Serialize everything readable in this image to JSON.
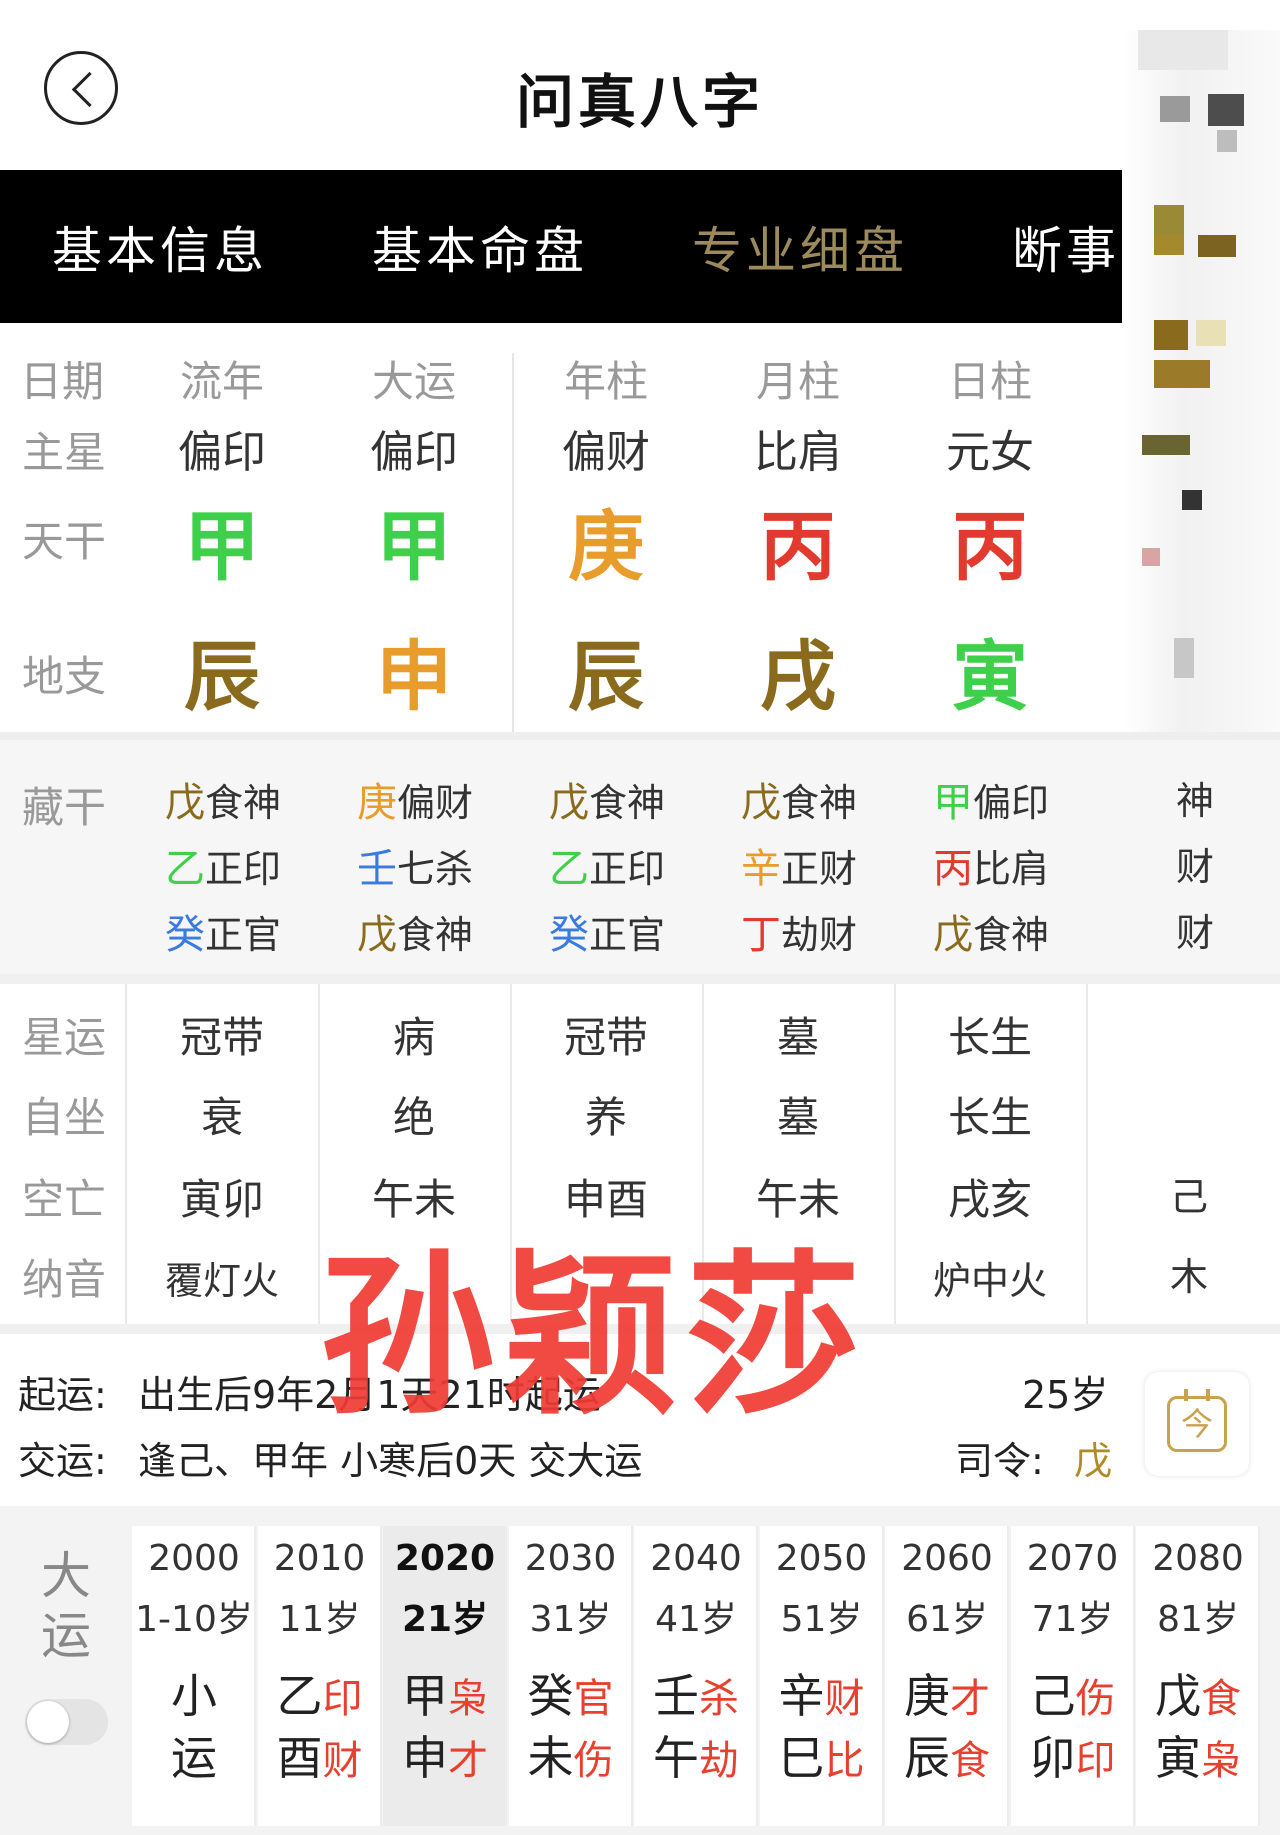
{
  "header": {
    "title": "问真八字"
  },
  "tabs": [
    "基本信息",
    "基本命盘",
    "专业细盘",
    "断事笔记"
  ],
  "row_labels": {
    "date": "日期",
    "star": "主星",
    "stem": "天干",
    "branch": "地支"
  },
  "columns": [
    {
      "head": "流年",
      "star": "偏印",
      "stem": "甲",
      "stem_color": "#3ed04a",
      "branch": "辰",
      "branch_color": "#8a6a1c"
    },
    {
      "head": "大运",
      "star": "偏印",
      "stem": "甲",
      "stem_color": "#3ed04a",
      "branch": "申",
      "branch_color": "#e79c2b"
    },
    {
      "head": "年柱",
      "star": "偏财",
      "stem": "庚",
      "stem_color": "#e79c2b",
      "branch": "辰",
      "branch_color": "#8a6a1c"
    },
    {
      "head": "月柱",
      "star": "比肩",
      "stem": "丙",
      "stem_color": "#e23a2f",
      "branch": "戌",
      "branch_color": "#8a6a1c"
    },
    {
      "head": "日柱",
      "star": "元女",
      "stem": "丙",
      "stem_color": "#e23a2f",
      "branch": "寅",
      "branch_color": "#3ed04a"
    }
  ],
  "hidden": {
    "label": "藏干",
    "columns": [
      [
        {
          "g": "戊",
          "c": "#8a6a1c",
          "t": "食神"
        },
        {
          "g": "乙",
          "c": "#3ed04a",
          "t": "正印"
        },
        {
          "g": "癸",
          "c": "#3a7be0",
          "t": "正官"
        }
      ],
      [
        {
          "g": "庚",
          "c": "#e79c2b",
          "t": "偏财"
        },
        {
          "g": "壬",
          "c": "#3a7be0",
          "t": "七杀"
        },
        {
          "g": "戊",
          "c": "#8a6a1c",
          "t": "食神"
        }
      ],
      [
        {
          "g": "戊",
          "c": "#8a6a1c",
          "t": "食神"
        },
        {
          "g": "乙",
          "c": "#3ed04a",
          "t": "正印"
        },
        {
          "g": "癸",
          "c": "#3a7be0",
          "t": "正官"
        }
      ],
      [
        {
          "g": "戊",
          "c": "#8a6a1c",
          "t": "食神"
        },
        {
          "g": "辛",
          "c": "#e79c2b",
          "t": "正财"
        },
        {
          "g": "丁",
          "c": "#e23a2f",
          "t": "劫财"
        }
      ],
      [
        {
          "g": "甲",
          "c": "#3ed04a",
          "t": "偏印"
        },
        {
          "g": "丙",
          "c": "#e23a2f",
          "t": "比肩"
        },
        {
          "g": "戊",
          "c": "#8a6a1c",
          "t": "食神"
        }
      ]
    ],
    "partial": [
      "神",
      "财",
      "财"
    ]
  },
  "luck": {
    "labels": [
      "星运",
      "自坐",
      "空亡",
      "纳音"
    ],
    "columns": [
      [
        "冠带",
        "衰",
        "寅卯",
        "覆灯火"
      ],
      [
        "病",
        "绝",
        "午未",
        ""
      ],
      [
        "冠带",
        "养",
        "申酉",
        ""
      ],
      [
        "墓",
        "墓",
        "午未",
        ""
      ],
      [
        "长生",
        "长生",
        "戌亥",
        "炉中火"
      ]
    ],
    "partial": [
      "",
      "",
      "己",
      "木"
    ]
  },
  "watermark": "孙颖莎",
  "info": {
    "qiyun_label": "起运:",
    "qiyun_text": "出生后9年2月1天21时起运",
    "jiaoyun_label": "交运:",
    "jiaoyun_text": "逢己、甲年 小寒后0天 交大运",
    "age": "25岁",
    "siling_label": "司令:",
    "siling_value": "戊",
    "calendar_glyph": "今"
  },
  "dayun": {
    "label_1": "大",
    "label_2": "运",
    "columns": [
      {
        "year": "2000",
        "age": "1-10岁",
        "s1": "小",
        "g1": "",
        "s2": "运",
        "g2": ""
      },
      {
        "year": "2010",
        "age": "11岁",
        "s1": "乙",
        "g1": "印",
        "s2": "酉",
        "g2": "财"
      },
      {
        "year": "2020",
        "age": "21岁",
        "s1": "甲",
        "g1": "枭",
        "s2": "申",
        "g2": "才",
        "current": true
      },
      {
        "year": "2030",
        "age": "31岁",
        "s1": "癸",
        "g1": "官",
        "s2": "未",
        "g2": "伤"
      },
      {
        "year": "2040",
        "age": "41岁",
        "s1": "壬",
        "g1": "杀",
        "s2": "午",
        "g2": "劫"
      },
      {
        "year": "2050",
        "age": "51岁",
        "s1": "辛",
        "g1": "财",
        "s2": "巳",
        "g2": "比"
      },
      {
        "year": "2060",
        "age": "61岁",
        "s1": "庚",
        "g1": "才",
        "s2": "辰",
        "g2": "食"
      },
      {
        "year": "2070",
        "age": "71岁",
        "s1": "己",
        "g1": "伤",
        "s2": "卯",
        "g2": "印"
      },
      {
        "year": "2080",
        "age": "81岁",
        "s1": "戊",
        "g1": "食",
        "s2": "寅",
        "g2": "枭"
      }
    ]
  }
}
